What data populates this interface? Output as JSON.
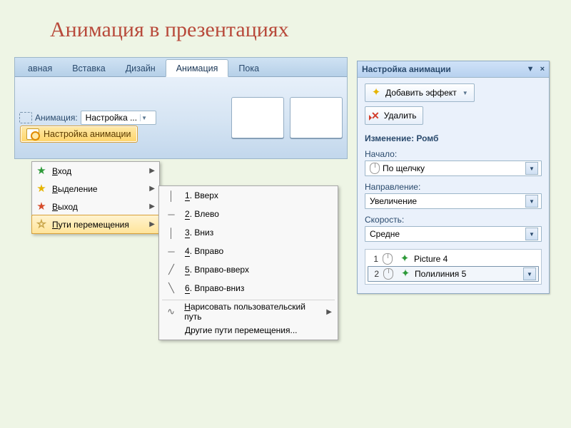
{
  "title": "Анимация в презентациях",
  "ribbon": {
    "tabs": [
      "авная",
      "Вставка",
      "Дизайн",
      "Анимация",
      "Пока"
    ],
    "active_index": 3,
    "anim_label": "Анимация:",
    "anim_value": "Настройка ...",
    "config_button": "Настройка анимации"
  },
  "menu1": {
    "items": [
      {
        "label": "Вход",
        "star": "green"
      },
      {
        "label": "Выделение",
        "star": "yellow"
      },
      {
        "label": "Выход",
        "star": "red"
      },
      {
        "label": "Пути перемещения",
        "star": "outline"
      }
    ],
    "hover_index": 3
  },
  "menu2": {
    "items": [
      {
        "num": "1",
        "glyph": "│",
        "label": "Вверх"
      },
      {
        "num": "2",
        "glyph": "─",
        "label": "Влево"
      },
      {
        "num": "3",
        "glyph": "│",
        "label": "Вниз"
      },
      {
        "num": "4",
        "glyph": "─",
        "label": "Вправо"
      },
      {
        "num": "5",
        "glyph": "╱",
        "label": "Вправо-вверх"
      },
      {
        "num": "6",
        "glyph": "╲",
        "label": "Вправо-вниз"
      }
    ],
    "freeform": "Нарисовать пользовательский путь",
    "more": "Другие пути перемещения..."
  },
  "pane": {
    "title": "Настройка анимации",
    "close": "×",
    "menu_arrow": "▼",
    "add_btn": "Добавить эффект",
    "remove_btn": "Удалить",
    "change_label": "Изменение: Ромб",
    "start_label": "Начало:",
    "start_value": "По щелчку",
    "dir_label": "Направление:",
    "dir_value": "Увеличение",
    "speed_label": "Скорость:",
    "speed_value": "Средне",
    "effects": [
      {
        "n": "1",
        "name": "Picture 4"
      },
      {
        "n": "2",
        "name": "Полилиния 5"
      }
    ],
    "selected_effect": 1
  }
}
